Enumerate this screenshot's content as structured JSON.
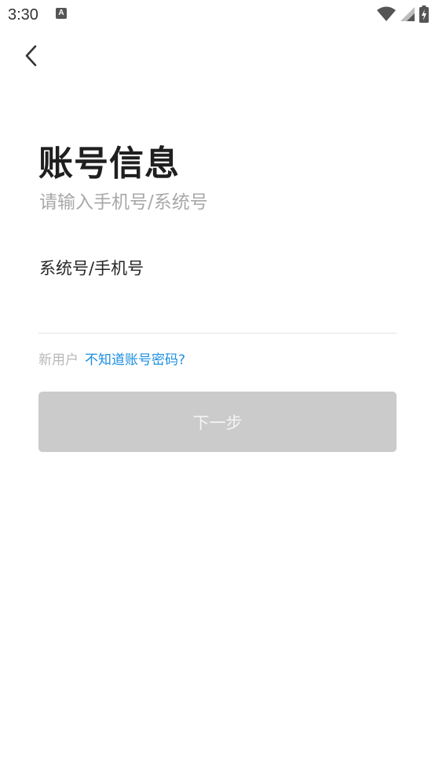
{
  "status_bar": {
    "time": "3:30",
    "notification_glyph": "A",
    "icons": [
      "wifi-icon",
      "signal-icon",
      "battery-charging-icon"
    ]
  },
  "nav": {
    "back_icon": "chevron-left-icon"
  },
  "header": {
    "title": "账号信息",
    "subtitle": "请输入手机号/系统号"
  },
  "form": {
    "account_label": "系统号/手机号",
    "account_value": "",
    "account_placeholder": ""
  },
  "help": {
    "new_user_text": "新用户",
    "forgot_link": "不知道账号密码?"
  },
  "actions": {
    "next_label": "下一步"
  },
  "colors": {
    "link": "#1d8fe0",
    "button_disabled": "#cbcbcb",
    "subtitle": "#a8a8a8"
  }
}
